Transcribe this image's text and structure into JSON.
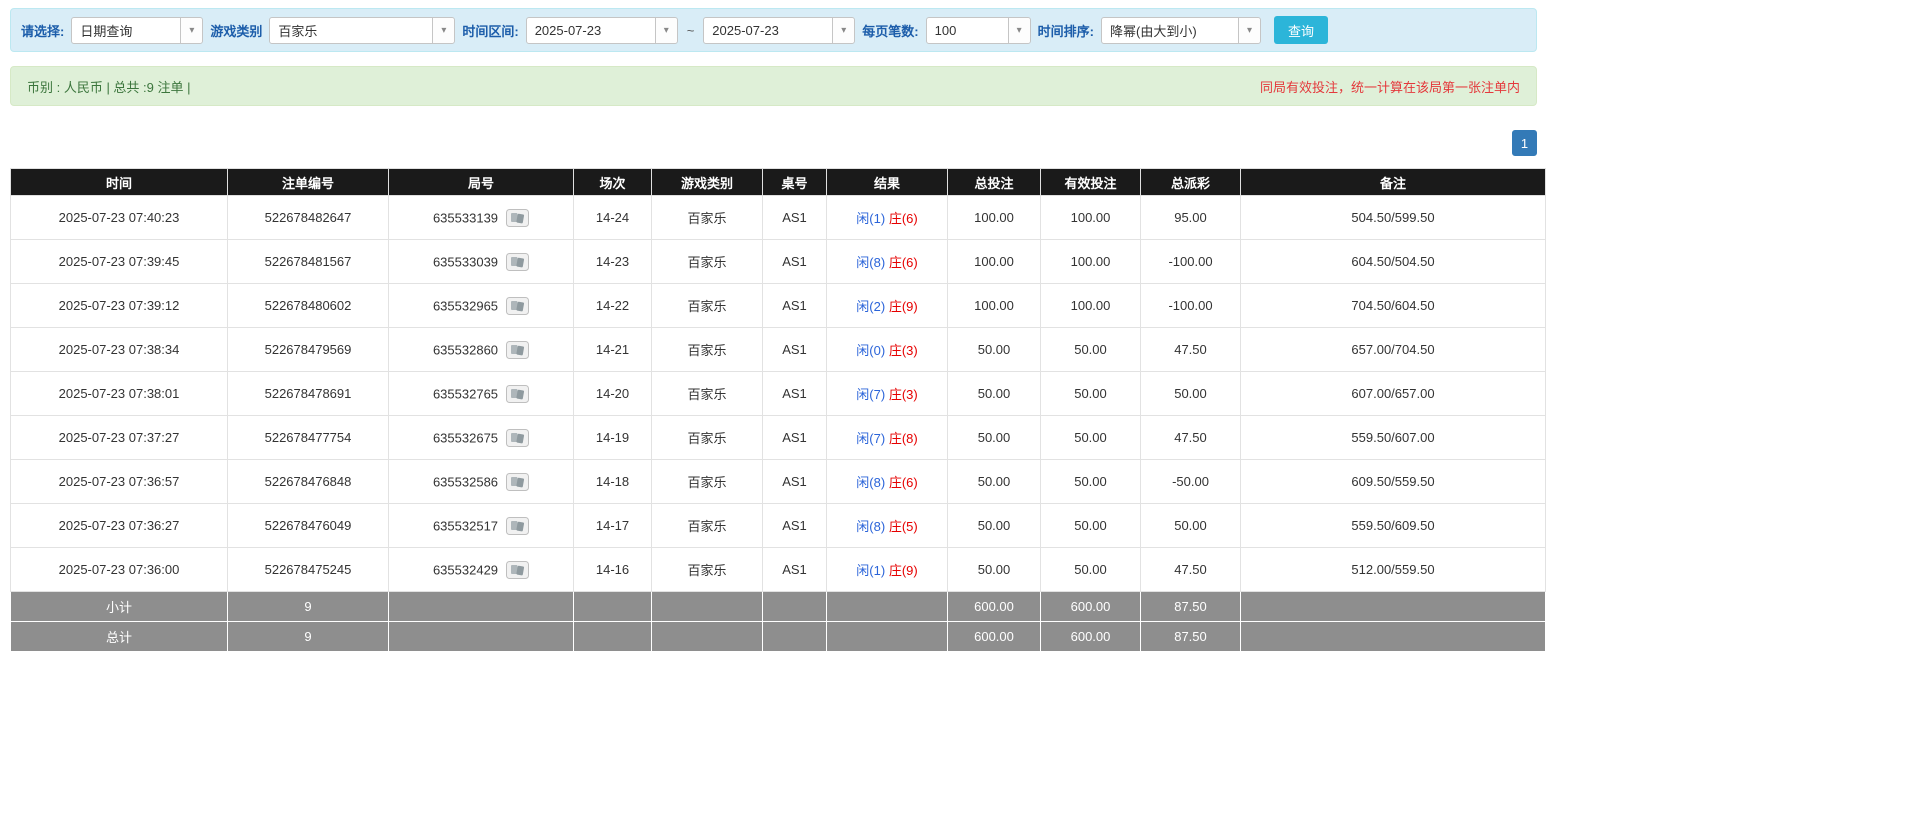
{
  "filters": {
    "select_label": "请选择:",
    "select_value": "日期查询",
    "game_type_label": "游戏类别",
    "game_type_value": "百家乐",
    "time_range_label": "时间区间:",
    "date_from": "2025-07-23",
    "range_separator": "~",
    "date_to": "2025-07-23",
    "page_size_label": "每页笔数:",
    "page_size_value": "100",
    "sort_label": "时间排序:",
    "sort_value": "降幂(由大到小)",
    "search_button": "查询"
  },
  "summary": {
    "left": "币别 : 人民币 | 总共 :9 注单 |",
    "right": "同局有效投注，统一计算在该局第一张注单内"
  },
  "pagination": {
    "current_page": "1"
  },
  "icons": {
    "chevron_down": "▾"
  },
  "colors": {
    "filter_bar_bg": "#d9edf7",
    "summary_bar_bg": "#dff0d8",
    "search_button_cyan": "#2cb5d9",
    "table_header_bg": "#1a1a1a",
    "footer_row_gray": "#8e8e8e",
    "link_blue": "#337ab7",
    "player_blue": "#2b64d9",
    "banker_red": "#e60000",
    "negative_red": "#e60000",
    "notice_red": "#e4393c",
    "label_blue": "#1c5daa",
    "pagination_blue": "#337ab7"
  },
  "table": {
    "headers": [
      "时间",
      "注单编号",
      "局号",
      "场次",
      "游戏类别",
      "桌号",
      "结果",
      "总投注",
      "有效投注",
      "总派彩",
      "备注"
    ],
    "rows": [
      {
        "time": "2025-07-23 07:40:23",
        "bet_id": "522678482647",
        "round_id": "635533139",
        "session": "14-24",
        "game_type": "百家乐",
        "table_no": "AS1",
        "result_player": "闲(1)",
        "result_banker": "庄(6)",
        "total_bet": "100.00",
        "valid_bet": "100.00",
        "payout": "95.00",
        "note": "504.50/599.50"
      },
      {
        "time": "2025-07-23 07:39:45",
        "bet_id": "522678481567",
        "round_id": "635533039",
        "session": "14-23",
        "game_type": "百家乐",
        "table_no": "AS1",
        "result_player": "闲(8)",
        "result_banker": "庄(6)",
        "total_bet": "100.00",
        "valid_bet": "100.00",
        "payout": "-100.00",
        "note": "604.50/504.50"
      },
      {
        "time": "2025-07-23 07:39:12",
        "bet_id": "522678480602",
        "round_id": "635532965",
        "session": "14-22",
        "game_type": "百家乐",
        "table_no": "AS1",
        "result_player": "闲(2)",
        "result_banker": "庄(9)",
        "total_bet": "100.00",
        "valid_bet": "100.00",
        "payout": "-100.00",
        "note": "704.50/604.50"
      },
      {
        "time": "2025-07-23 07:38:34",
        "bet_id": "522678479569",
        "round_id": "635532860",
        "session": "14-21",
        "game_type": "百家乐",
        "table_no": "AS1",
        "result_player": "闲(0)",
        "result_banker": "庄(3)",
        "total_bet": "50.00",
        "valid_bet": "50.00",
        "payout": "47.50",
        "note": "657.00/704.50"
      },
      {
        "time": "2025-07-23 07:38:01",
        "bet_id": "522678478691",
        "round_id": "635532765",
        "session": "14-20",
        "game_type": "百家乐",
        "table_no": "AS1",
        "result_player": "闲(7)",
        "result_banker": "庄(3)",
        "total_bet": "50.00",
        "valid_bet": "50.00",
        "payout": "50.00",
        "note": "607.00/657.00"
      },
      {
        "time": "2025-07-23 07:37:27",
        "bet_id": "522678477754",
        "round_id": "635532675",
        "session": "14-19",
        "game_type": "百家乐",
        "table_no": "AS1",
        "result_player": "闲(7)",
        "result_banker": "庄(8)",
        "total_bet": "50.00",
        "valid_bet": "50.00",
        "payout": "47.50",
        "note": "559.50/607.00"
      },
      {
        "time": "2025-07-23 07:36:57",
        "bet_id": "522678476848",
        "round_id": "635532586",
        "session": "14-18",
        "game_type": "百家乐",
        "table_no": "AS1",
        "result_player": "闲(8)",
        "result_banker": "庄(6)",
        "total_bet": "50.00",
        "valid_bet": "50.00",
        "payout": "-50.00",
        "note": "609.50/559.50"
      },
      {
        "time": "2025-07-23 07:36:27",
        "bet_id": "522678476049",
        "round_id": "635532517",
        "session": "14-17",
        "game_type": "百家乐",
        "table_no": "AS1",
        "result_player": "闲(8)",
        "result_banker": "庄(5)",
        "total_bet": "50.00",
        "valid_bet": "50.00",
        "payout": "50.00",
        "note": "559.50/609.50"
      },
      {
        "time": "2025-07-23 07:36:00",
        "bet_id": "522678475245",
        "round_id": "635532429",
        "session": "14-16",
        "game_type": "百家乐",
        "table_no": "AS1",
        "result_player": "闲(1)",
        "result_banker": "庄(9)",
        "total_bet": "50.00",
        "valid_bet": "50.00",
        "payout": "47.50",
        "note": "512.00/559.50"
      }
    ],
    "subtotal": {
      "label": "小计",
      "count": "9",
      "total_bet": "600.00",
      "valid_bet": "600.00",
      "payout": "87.50"
    },
    "total": {
      "label": "总计",
      "count": "9",
      "total_bet": "600.00",
      "valid_bet": "600.00",
      "payout": "87.50"
    }
  }
}
